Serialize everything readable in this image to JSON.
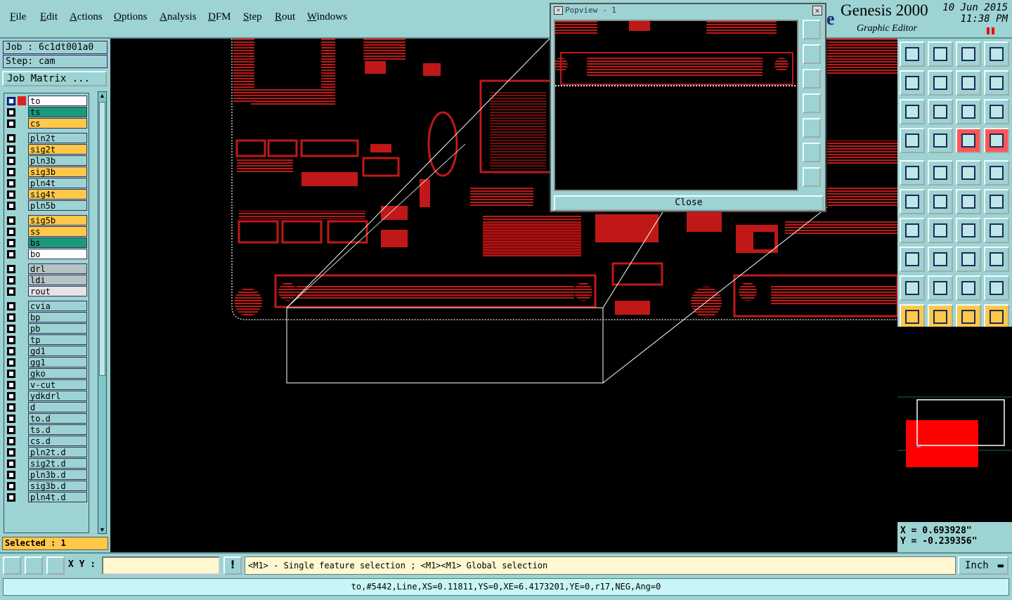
{
  "menu": [
    "File",
    "Edit",
    "Actions",
    "Options",
    "Analysis",
    "DFM",
    "Step",
    "Rout",
    "Windows"
  ],
  "brand": {
    "name": "Genesis 2000",
    "subtitle": "Graphic Editor",
    "date": "10 Jun 2015",
    "time": "11:38 PM"
  },
  "job": {
    "job_label": "Job : 6c1dt001a0",
    "step_label": "Step: cam",
    "matrix_button": "Job Matrix ..."
  },
  "layers": [
    {
      "name": "to",
      "color": "#ffffff"
    },
    {
      "name": "ts",
      "color": "#1a9a7a"
    },
    {
      "name": "cs",
      "color": "#ffc84a"
    },
    {
      "name": "pln2t",
      "color": "#9dd3d3"
    },
    {
      "name": "sig2t",
      "color": "#ffc84a"
    },
    {
      "name": "pln3b",
      "color": "#9dd3d3"
    },
    {
      "name": "sig3b",
      "color": "#ffc84a"
    },
    {
      "name": "pln4t",
      "color": "#9dd3d3"
    },
    {
      "name": "sig4t",
      "color": "#ffc84a"
    },
    {
      "name": "pln5b",
      "color": "#9dd3d3"
    },
    {
      "name": "sig5b",
      "color": "#ffc84a"
    },
    {
      "name": "ss",
      "color": "#ffc84a"
    },
    {
      "name": "bs",
      "color": "#1a9a7a"
    },
    {
      "name": "bo",
      "color": "#ffffff"
    },
    {
      "name": "drl",
      "color": "#b4c4c4"
    },
    {
      "name": "ldi",
      "color": "#b4c4c4"
    },
    {
      "name": "rout",
      "color": "#e4e4e4"
    },
    {
      "name": "cvia",
      "color": "#9dd3d3"
    },
    {
      "name": "bp",
      "color": "#9dd3d3"
    },
    {
      "name": "pb",
      "color": "#9dd3d3"
    },
    {
      "name": "tp",
      "color": "#9dd3d3"
    },
    {
      "name": "gd1",
      "color": "#9dd3d3"
    },
    {
      "name": "gg1",
      "color": "#9dd3d3"
    },
    {
      "name": "gko",
      "color": "#9dd3d3"
    },
    {
      "name": "v-cut",
      "color": "#9dd3d3"
    },
    {
      "name": "ydkdrl",
      "color": "#9dd3d3"
    },
    {
      "name": "d",
      "color": "#9dd3d3"
    },
    {
      "name": "to.d",
      "color": "#9dd3d3"
    },
    {
      "name": "ts.d",
      "color": "#9dd3d3"
    },
    {
      "name": "cs.d",
      "color": "#9dd3d3"
    },
    {
      "name": "pln2t.d",
      "color": "#9dd3d3"
    },
    {
      "name": "sig2t.d",
      "color": "#9dd3d3"
    },
    {
      "name": "pln3b.d",
      "color": "#9dd3d3"
    },
    {
      "name": "sig3b.d",
      "color": "#9dd3d3"
    },
    {
      "name": "pln4t.d",
      "color": "#9dd3d3"
    }
  ],
  "selected_text": "Selected : 1",
  "popview": {
    "title": "Popview - 1",
    "close_label": "Close"
  },
  "coords": {
    "x": "X = 0.693928\"",
    "y": "Y = -0.239356\""
  },
  "xy": {
    "label": "X Y :",
    "value": ""
  },
  "message": "<M1> - Single feature selection ; <M1><M1> Global selection",
  "unit": "Inch",
  "status": "to,#5442,Line,XS=0.11811,YS=0,XE=6.4173201,YE=0,r17,NEG,Ang=0",
  "colors": {
    "pcb_red": "#d01818",
    "panel": "#9dd3d3",
    "highlight": "#ffc84a"
  }
}
